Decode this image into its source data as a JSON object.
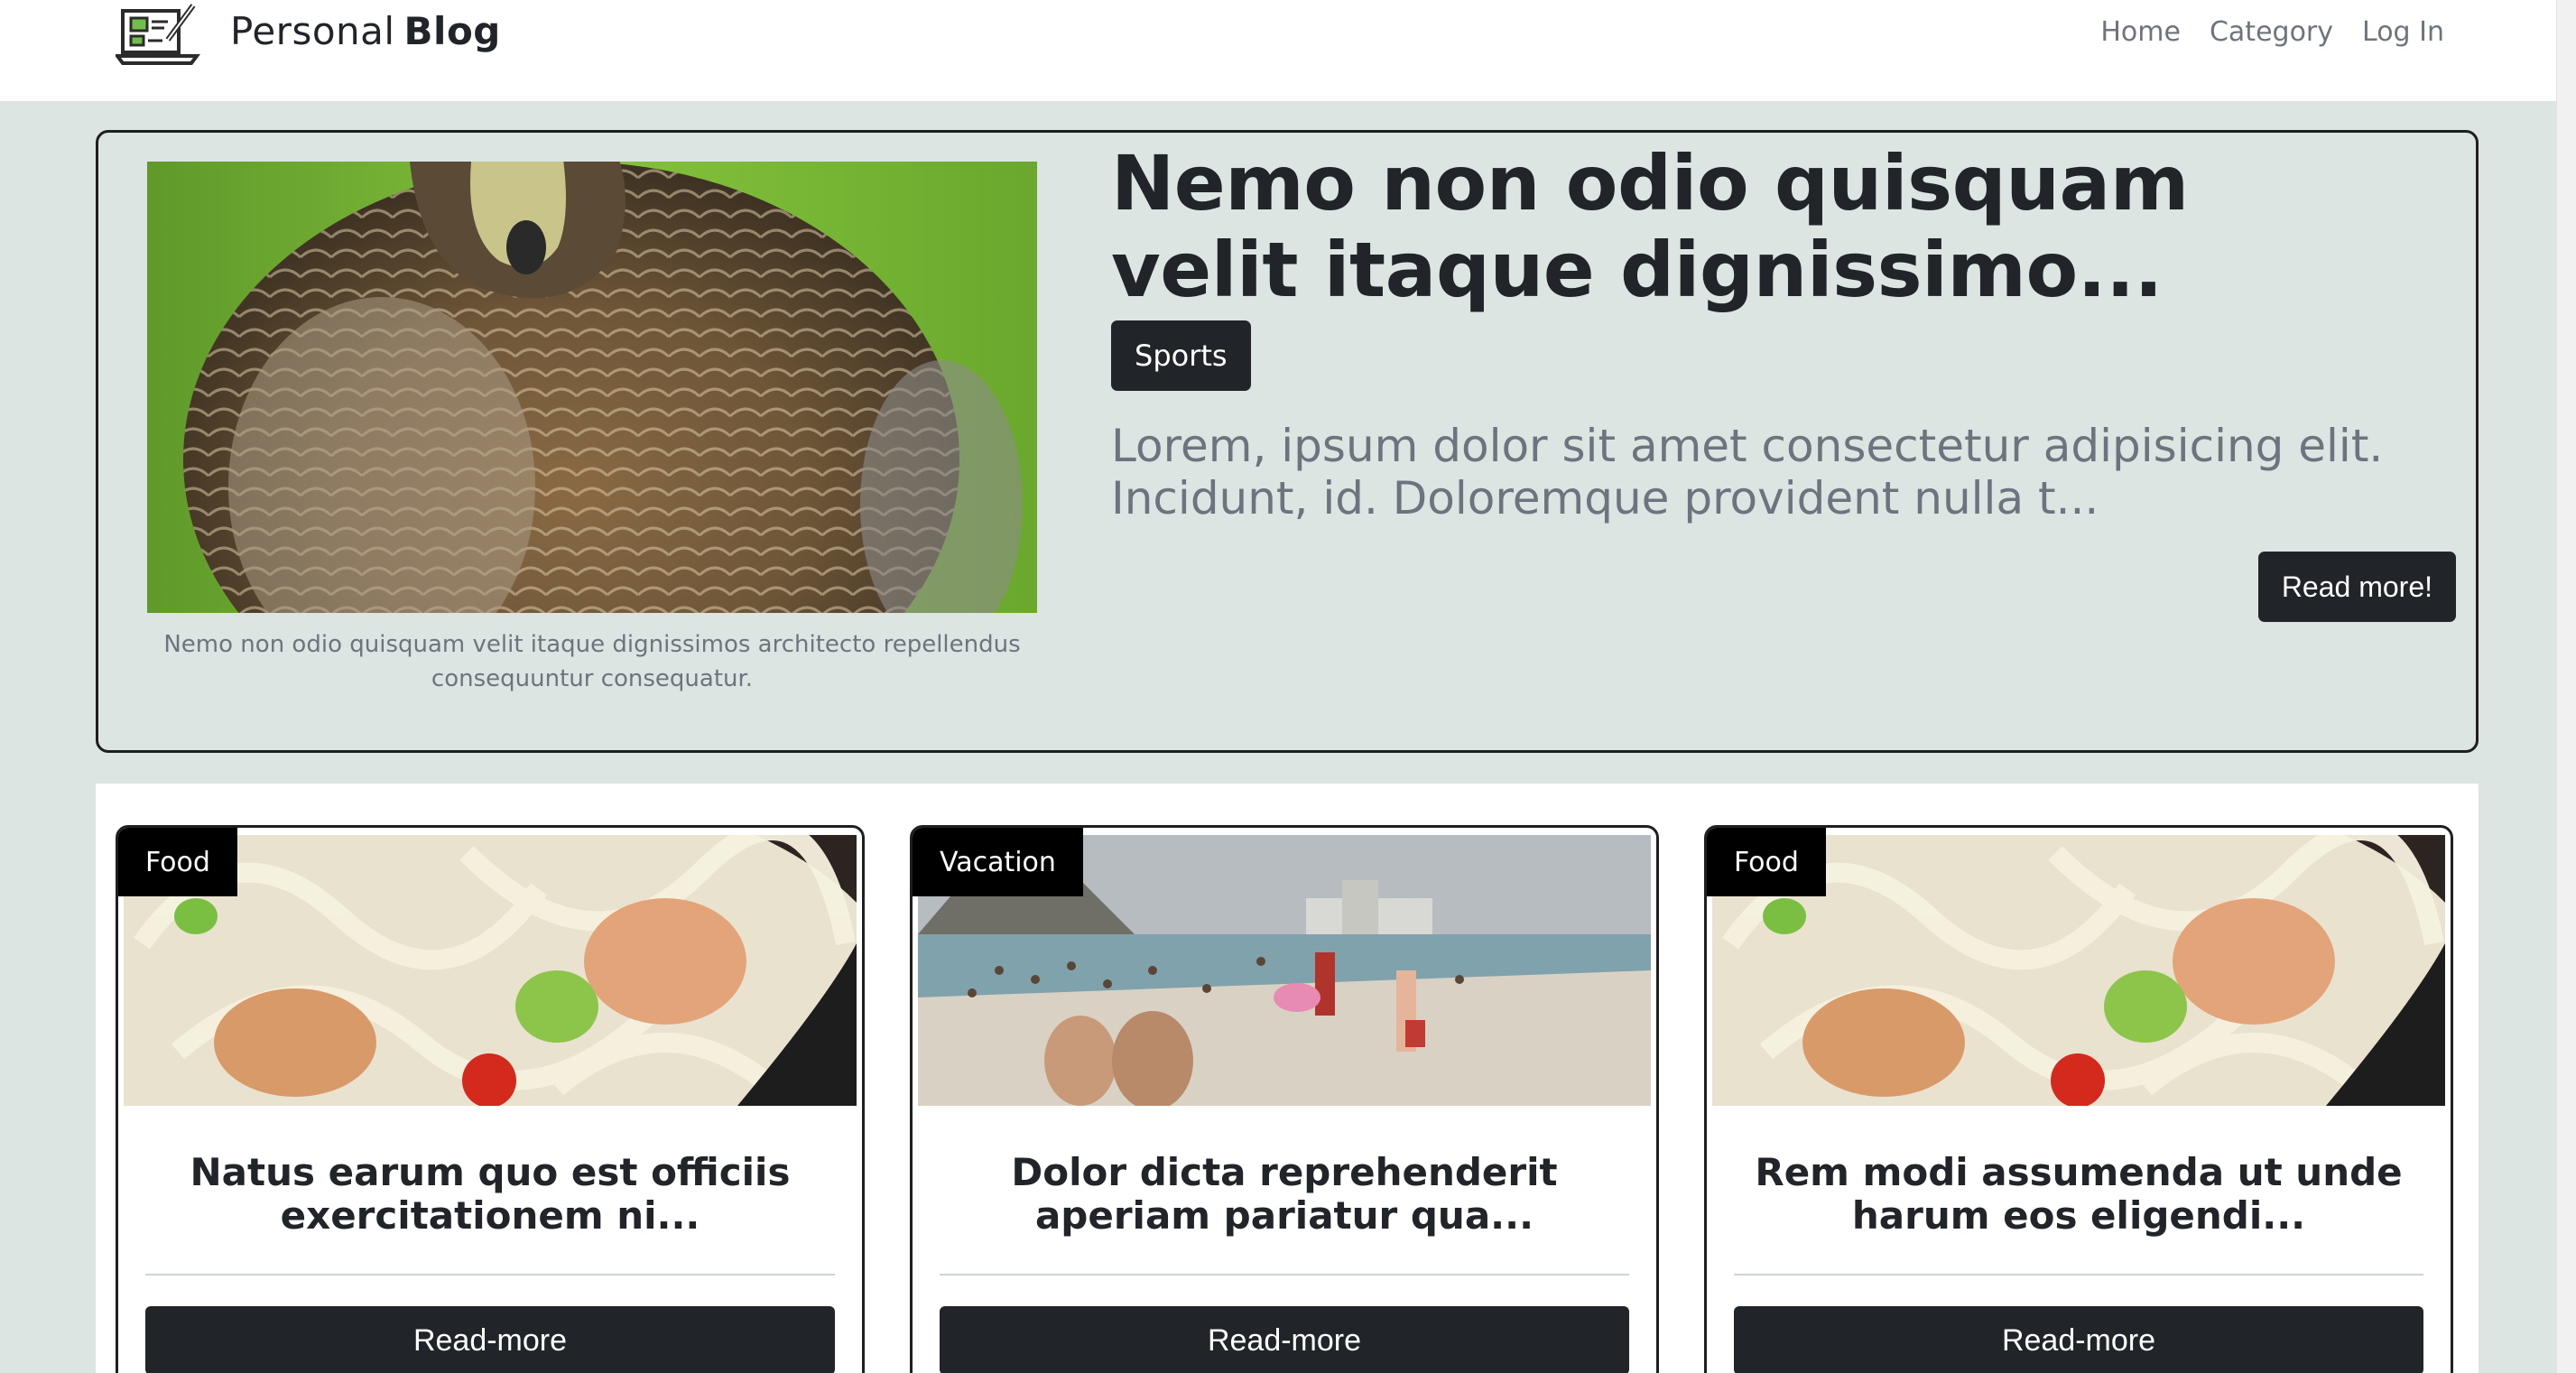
{
  "header": {
    "logo_icon": "laptop-edit-icon",
    "brand_plain": "Personal",
    "brand_strong": "Blog",
    "nav": [
      "Home",
      "Category",
      "Log In"
    ]
  },
  "featured": {
    "image": "duck-close-up-photo",
    "caption": "Nemo non odio quisquam velit itaque dignissimos architecto repellendus consequuntur consequatur.",
    "title": "Nemo non odio quisquam velit itaque dignissimo...",
    "category": "Sports",
    "excerpt": "Lorem, ipsum dolor sit amet consectetur adipisicing elit. Incidunt, id. Doloremque provident nulla t...",
    "read_more": "Read more!"
  },
  "cards": [
    {
      "category": "Food",
      "image": "noodle-bowl-photo",
      "title": "Natus earum quo est officiis exercitationem ni...",
      "button": "Read-more"
    },
    {
      "category": "Vacation",
      "image": "beach-crowd-photo",
      "title": "Dolor dicta reprehenderit aperiam pariatur qua...",
      "button": "Read-more"
    },
    {
      "category": "Food",
      "image": "noodle-bowl-photo",
      "title": "Rem modi assumenda ut unde harum eos eligendi...",
      "button": "Read-more"
    }
  ],
  "colors": {
    "page_bg": "#dde5e3",
    "dark": "#212529",
    "muted": "#6c757d",
    "white": "#ffffff"
  }
}
